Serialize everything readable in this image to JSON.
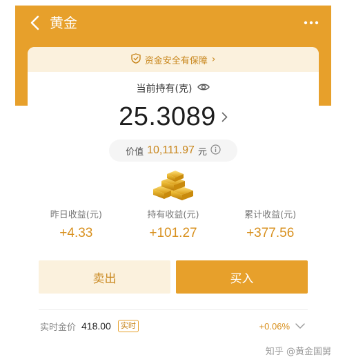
{
  "header": {
    "title": "黄金"
  },
  "card": {
    "security_text": "资金安全有保障",
    "security_arrow": "›",
    "holding_label": "当前持有(克)",
    "holding_amount": "25.3089",
    "value_label": "价值",
    "value_amount": "10,111.97",
    "value_unit": "元"
  },
  "stats": [
    {
      "label": "昨日收益(元)",
      "value": "+4.33"
    },
    {
      "label": "持有收益(元)",
      "value": "+101.27"
    },
    {
      "label": "累计收益(元)",
      "value": "+377.56"
    }
  ],
  "actions": {
    "sell": "卖出",
    "buy": "买入"
  },
  "price": {
    "label": "实时金价",
    "value": "418.00",
    "tag": "实时",
    "change": "+0.06%"
  },
  "watermark": "知乎 @黄金国舅",
  "icons": [
    "back-icon",
    "more-icon",
    "shield-icon",
    "eye-icon",
    "chevron-right-icon",
    "info-icon",
    "gold-bars-icon",
    "chevron-down-icon"
  ],
  "colors": {
    "accent": "#E7A02B",
    "accent_text": "#C8861C",
    "light_accent_bg": "#FBF1DD"
  }
}
